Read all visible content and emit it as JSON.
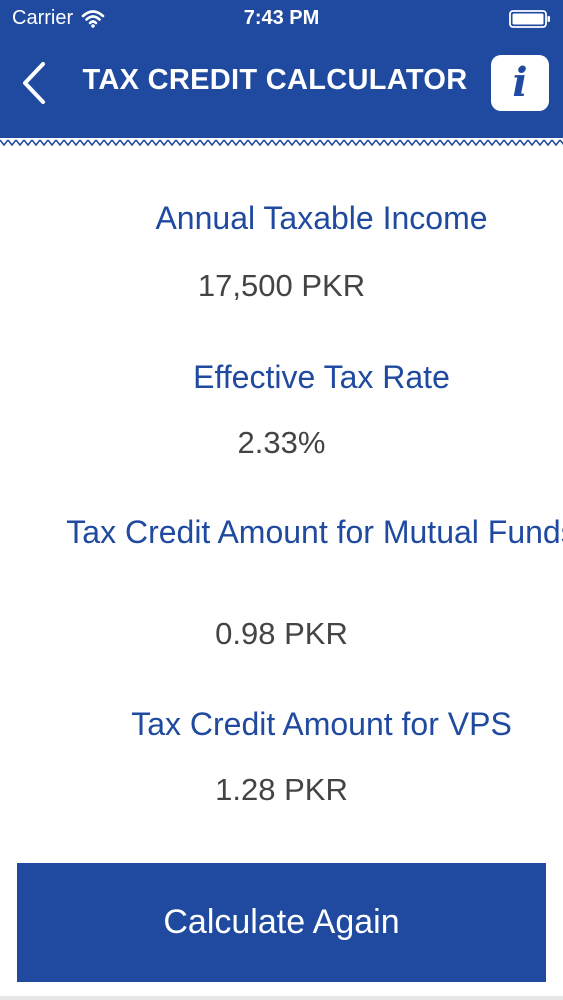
{
  "status_bar": {
    "carrier": "Carrier",
    "time": "7:43 PM",
    "icons": [
      "wifi-icon",
      "battery-icon"
    ]
  },
  "nav": {
    "title": "TAX CREDIT CALCULATOR",
    "back_icon": "chevron-left-icon",
    "info_icon": "info-icon",
    "info_glyph": "i"
  },
  "results": [
    {
      "label": "Annual Taxable Income",
      "value": "17,500 PKR"
    },
    {
      "label": "Effective Tax Rate",
      "value": "2.33%"
    },
    {
      "label": "Tax Credit Amount for Mutual Funds",
      "value": "0.98 PKR"
    },
    {
      "label": "Tax Credit Amount for VPS",
      "value": "1.28 PKR"
    }
  ],
  "actions": {
    "calculate_again_label": "Calculate Again"
  },
  "colors": {
    "primary": "#1f4aa0",
    "value_text": "#444444",
    "background": "#ffffff"
  }
}
